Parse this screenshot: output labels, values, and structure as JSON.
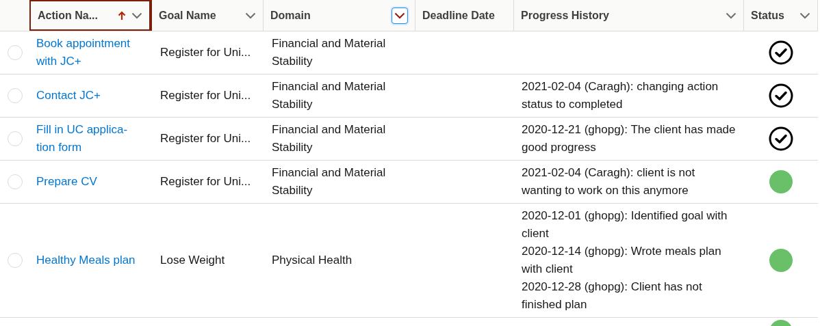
{
  "table": {
    "columns": [
      {
        "label": "Action Na...",
        "sorted": true,
        "focused": false,
        "menu": true
      },
      {
        "label": "Goal Name",
        "sorted": false,
        "focused": false,
        "menu": true
      },
      {
        "label": "Domain",
        "sorted": false,
        "focused": true,
        "menu": true
      },
      {
        "label": "Deadline Date",
        "sorted": false,
        "focused": false,
        "menu": false
      },
      {
        "label": "Progress History",
        "sorted": false,
        "focused": false,
        "menu": true
      },
      {
        "label": "Status",
        "sorted": false,
        "focused": false,
        "menu": true
      }
    ],
    "rows": [
      {
        "selected": false,
        "action": "Book appointment with JC+",
        "goal": "Register for Uni...",
        "domain": "Financial and Material Stability",
        "history": [],
        "kind": "done"
      },
      {
        "selected": false,
        "action": "Contact JC+",
        "goal": "Register for Uni...",
        "domain": "Financial and Material Stability",
        "history": [
          "2021-02-04 (Caragh): changing action status to completed"
        ],
        "kind": "done"
      },
      {
        "selected": false,
        "action": "Fill in UC applica-tion form",
        "goal": "Register for Uni...",
        "domain": "Financial and Material Stability",
        "history": [
          "2020-12-21 (ghopg): The client has made good progress"
        ],
        "kind": "done"
      },
      {
        "selected": false,
        "action": "Prepare CV",
        "goal": "Register for Uni...",
        "domain": "Financial and Material Stability",
        "history": [
          "2021-02-04 (Caragh): client is not wanting to work on this anymore"
        ],
        "kind": "active"
      },
      {
        "selected": false,
        "action": "Healthy Meals plan",
        "goal": "Lose Weight",
        "domain": "Physical Health",
        "history": [
          "2020-12-01 (ghopg): Identified goal with client",
          "2020-12-14 (ghopg): Wrote meals plan with client",
          "2020-12-28 (ghopg): Client has not finished plan"
        ],
        "kind": "active"
      },
      {
        "kind": "active"
      }
    ]
  }
}
